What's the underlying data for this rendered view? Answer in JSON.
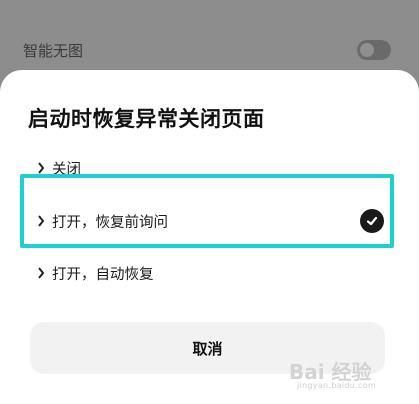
{
  "background": {
    "setting_label": "智能无图",
    "toggle_on": false
  },
  "dialog": {
    "title": "启动时恢复异常关闭页面",
    "options": [
      {
        "label": "关闭",
        "selected": false
      },
      {
        "label": "打开，恢复前询问",
        "selected": true
      },
      {
        "label": "打开，自动恢复",
        "selected": false
      }
    ],
    "cancel_label": "取消"
  },
  "watermark": {
    "main": "Bai 经验",
    "sub": "jingyan.baidu.com"
  },
  "colors": {
    "highlight": "#1ccfd0",
    "overlay": "#8c8c8c",
    "check": "#1a1a1a"
  }
}
